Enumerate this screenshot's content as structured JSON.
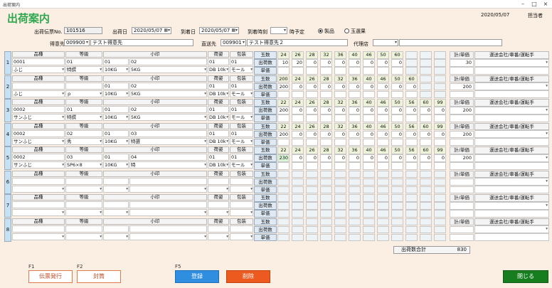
{
  "window": {
    "title": "出荷案内"
  },
  "header": {
    "title": "出荷案内",
    "date": "2020/05/07",
    "user_label": "担当者"
  },
  "form": {
    "slip_no_label": "出荷伝票No.",
    "slip_no": "101516",
    "ship_date_label": "出荷日",
    "ship_date": "2020/05/07",
    "arrival_date_label": "到着日",
    "arrival_date": "2020/05/07",
    "arrival_time_label": "到着時刻",
    "arrival_time": "",
    "time_suffix": "時予定",
    "radio_product": "製品",
    "radio_sorted": "玉選果",
    "customer_label": "得意先",
    "customer_code": "009900",
    "customer_name": "テスト得意先",
    "dest_label": "直送先",
    "dest_code": "009901",
    "dest_name": "テスト得意先２",
    "agent_label": "代理店",
    "agent_code": "",
    "agent_name": ""
  },
  "headers": {
    "hinshu": "品種",
    "tokyu": "等級",
    "koin": "小印",
    "nisugata": "荷姿",
    "hoso": "包装",
    "tamasu": "玉数",
    "shukkasu": "出荷数",
    "tanka": "単価",
    "total": "計/単価",
    "transport": "運送会社/車番/運転手"
  },
  "rows": [
    {
      "num": "1",
      "cells": {
        "h1": "0001",
        "h2": "ふじ",
        "t1": "01",
        "t2": "特撰",
        "k1": "01",
        "k2": "10KG",
        "k3": "02",
        "k4": "5KG",
        "n1": "01",
        "n2": "DB 10k",
        "p1": "01",
        "p2": "モール"
      },
      "tama": [
        "24",
        "26",
        "28",
        "32",
        "36",
        "40",
        "46",
        "50",
        "60",
        "",
        "",
        ""
      ],
      "qty": [
        "10",
        "20",
        "0",
        "0",
        "0",
        "0",
        "0",
        "0",
        "0",
        "",
        "",
        ""
      ],
      "total": "30"
    },
    {
      "num": "2",
      "cells": {
        "h1": "",
        "h2": "ふじ",
        "t1": "",
        "t2": "ｐ",
        "k1": "01",
        "k2": "10KG",
        "k3": "02",
        "k4": "5KG",
        "n1": "01",
        "n2": "DB 10k",
        "p1": "01",
        "p2": "モール"
      },
      "tama": [
        "200",
        "24",
        "26",
        "28",
        "32",
        "36",
        "40",
        "46",
        "50",
        "60",
        "",
        ""
      ],
      "qty": [
        "200",
        "0",
        "0",
        "0",
        "0",
        "0",
        "0",
        "0",
        "0",
        "0",
        "",
        ""
      ],
      "total": "200"
    },
    {
      "num": "3",
      "cells": {
        "h1": "0002",
        "h2": "サンふじ",
        "t1": "01",
        "t2": "特撰",
        "k1": "01",
        "k2": "10KG",
        "k3": "02",
        "k4": "5KG",
        "n1": "01",
        "n2": "DB 10k",
        "p1": "01",
        "p2": "モール"
      },
      "tama": [
        "22",
        "24",
        "26",
        "28",
        "32",
        "36",
        "40",
        "46",
        "50",
        "56",
        "60",
        "99"
      ],
      "qty": [
        "200",
        "0",
        "0",
        "0",
        "0",
        "0",
        "0",
        "0",
        "0",
        "0",
        "0",
        "0"
      ],
      "total": "200"
    },
    {
      "num": "4",
      "cells": {
        "h1": "0002",
        "h2": "サンふじ",
        "t1": "02",
        "t2": "秀",
        "k1": "01",
        "k2": "10KG",
        "k3": "03",
        "k4": "特選",
        "n1": "01",
        "n2": "DB 10k",
        "p1": "01",
        "p2": "モール"
      },
      "tama": [
        "22",
        "24",
        "26",
        "28",
        "32",
        "36",
        "40",
        "46",
        "50",
        "56",
        "60",
        "99"
      ],
      "qty": [
        "200",
        "0",
        "0",
        "0",
        "0",
        "0",
        "0",
        "0",
        "0",
        "0",
        "0",
        "0"
      ],
      "total": "200"
    },
    {
      "num": "5",
      "cells": {
        "h1": "0002",
        "h2": "サンふじ",
        "t1": "03",
        "t2": "SP6×8",
        "k1": "01",
        "k2": "10KG",
        "k3": "04",
        "k4": "特",
        "n1": "01",
        "n2": "DB 10k",
        "p1": "01",
        "p2": "モール"
      },
      "tama": [
        "22",
        "24",
        "26",
        "28",
        "32",
        "36",
        "40",
        "46",
        "50",
        "56",
        "60",
        "99"
      ],
      "qty": [
        "230",
        "0",
        "0",
        "0",
        "0",
        "0",
        "0",
        "0",
        "0",
        "0",
        "0",
        "0"
      ],
      "total": "200"
    },
    {
      "num": "6",
      "cells": {
        "h1": "",
        "h2": "",
        "t1": "",
        "t2": "",
        "k1": "",
        "k2": "",
        "k3": "",
        "k4": "",
        "n1": "",
        "n2": "",
        "p1": "",
        "p2": ""
      },
      "tama": [
        "",
        "",
        "",
        "",
        "",
        "",
        "",
        "",
        "",
        "",
        "",
        ""
      ],
      "qty": [
        "",
        "",
        "",
        "",
        "",
        "",
        "",
        "",
        "",
        "",
        "",
        ""
      ],
      "total": ""
    },
    {
      "num": "7",
      "cells": {
        "h1": "",
        "h2": "",
        "t1": "",
        "t2": "",
        "k1": "",
        "k2": "",
        "k3": "",
        "k4": "",
        "n1": "",
        "n2": "",
        "p1": "",
        "p2": ""
      },
      "tama": [
        "",
        "",
        "",
        "",
        "",
        "",
        "",
        "",
        "",
        "",
        "",
        ""
      ],
      "qty": [
        "",
        "",
        "",
        "",
        "",
        "",
        "",
        "",
        "",
        "",
        "",
        ""
      ],
      "total": ""
    },
    {
      "num": "8",
      "cells": {
        "h1": "",
        "h2": "",
        "t1": "",
        "t2": "",
        "k1": "",
        "k2": "",
        "k3": "",
        "k4": "",
        "n1": "",
        "n2": "",
        "p1": "",
        "p2": ""
      },
      "tama": [
        "",
        "",
        "",
        "",
        "",
        "",
        "",
        "",
        "",
        "",
        "",
        ""
      ],
      "qty": [
        "",
        "",
        "",
        "",
        "",
        "",
        "",
        "",
        "",
        "",
        "",
        ""
      ],
      "total": ""
    }
  ],
  "summary": {
    "label": "出荷数合計",
    "value": "830"
  },
  "footer": {
    "f1": "F1",
    "f2": "F2",
    "f5": "F5",
    "print_slip": "伝票発行",
    "envelope": "封筒",
    "register": "登録",
    "delete": "削除",
    "close": "閉じる"
  },
  "colors": {
    "title_green": "#2fa84f",
    "accent_blue": "#2f8ee0",
    "accent_red": "#ec5a1f",
    "accent_green": "#167e1f"
  }
}
